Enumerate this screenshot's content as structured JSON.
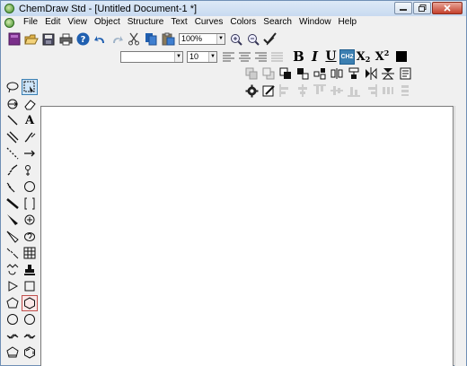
{
  "window": {
    "title": "ChemDraw Std - [Untitled Document-1 *]",
    "buttons": [
      "minimize",
      "restore",
      "close"
    ]
  },
  "menu": [
    "File",
    "Edit",
    "View",
    "Object",
    "Structure",
    "Text",
    "Curves",
    "Colors",
    "Search",
    "Window",
    "Help"
  ],
  "toolbar": {
    "zoom_value": "100%",
    "font_value": "",
    "font_size_value": "10",
    "bold_label": "B",
    "italic_label": "I",
    "underline_label": "U",
    "formula_label": "CH2",
    "subscript_label": "X",
    "subscript_suffix": "2",
    "superscript_label": "X",
    "superscript_suffix": "2"
  },
  "palette_text": {
    "text_tool_label": "A"
  },
  "colors": {
    "accent_blue": "#1f5fb0",
    "selection_red": "#c0504d",
    "canvas": "#ffffff",
    "chrome": "#f0f0f0"
  }
}
